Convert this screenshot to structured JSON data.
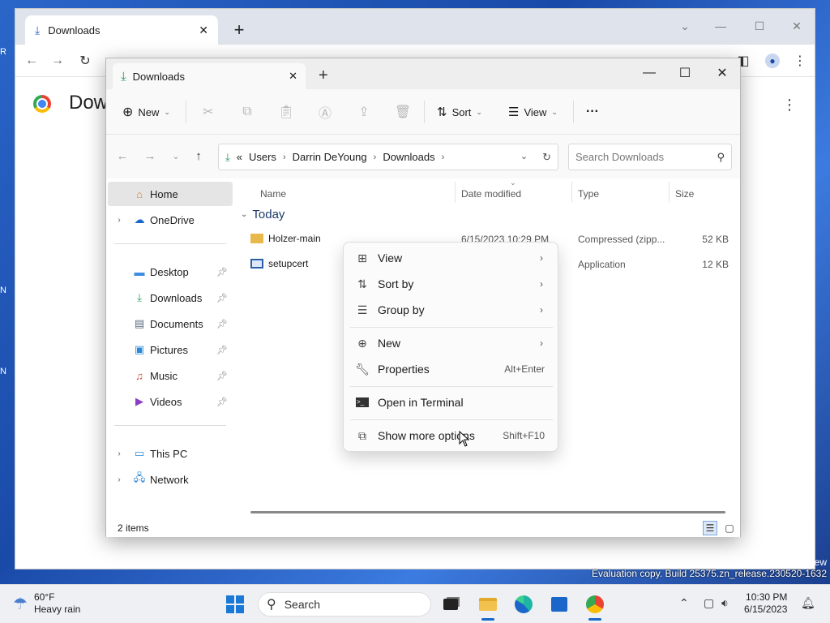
{
  "desktop": {
    "fragments": [
      "R",
      "N",
      "N"
    ],
    "eval_text": "Evaluation copy. Build 25375.zn_release.230520-1632",
    "corner_text": "ew"
  },
  "chrome": {
    "tab_title": "Downloads",
    "page_title": "Dow"
  },
  "explorer": {
    "tab_title": "Downloads",
    "commands": {
      "new_label": "New",
      "sort_label": "Sort",
      "view_label": "View",
      "more_label": "···"
    },
    "address": {
      "prefix": "«",
      "crumbs": [
        "Users",
        "Darrin DeYoung",
        "Downloads"
      ]
    },
    "search_placeholder": "Search Downloads",
    "nav": {
      "home": "Home",
      "onedrive": "OneDrive",
      "pinned": [
        "Desktop",
        "Downloads",
        "Documents",
        "Pictures",
        "Music",
        "Videos"
      ],
      "this_pc": "This PC",
      "network": "Network"
    },
    "columns": [
      "Name",
      "Date modified",
      "Type",
      "Size"
    ],
    "group_label": "Today",
    "files": [
      {
        "name": "Holzer-main",
        "date": "6/15/2023 10:29 PM",
        "type": "Compressed (zipp...",
        "size": "52 KB"
      },
      {
        "name": "setupcert",
        "date": "",
        "type": "Application",
        "size": "12 KB"
      }
    ],
    "status": "2 items"
  },
  "context_menu": {
    "view": "View",
    "sort_by": "Sort by",
    "group_by": "Group by",
    "new": "New",
    "properties": "Properties",
    "properties_shortcut": "Alt+Enter",
    "open_terminal": "Open in Terminal",
    "show_more": "Show more options",
    "show_more_shortcut": "Shift+F10"
  },
  "taskbar": {
    "temp": "60°F",
    "weather": "Heavy rain",
    "search_label": "Search",
    "time": "10:30 PM",
    "date": "6/15/2023"
  }
}
